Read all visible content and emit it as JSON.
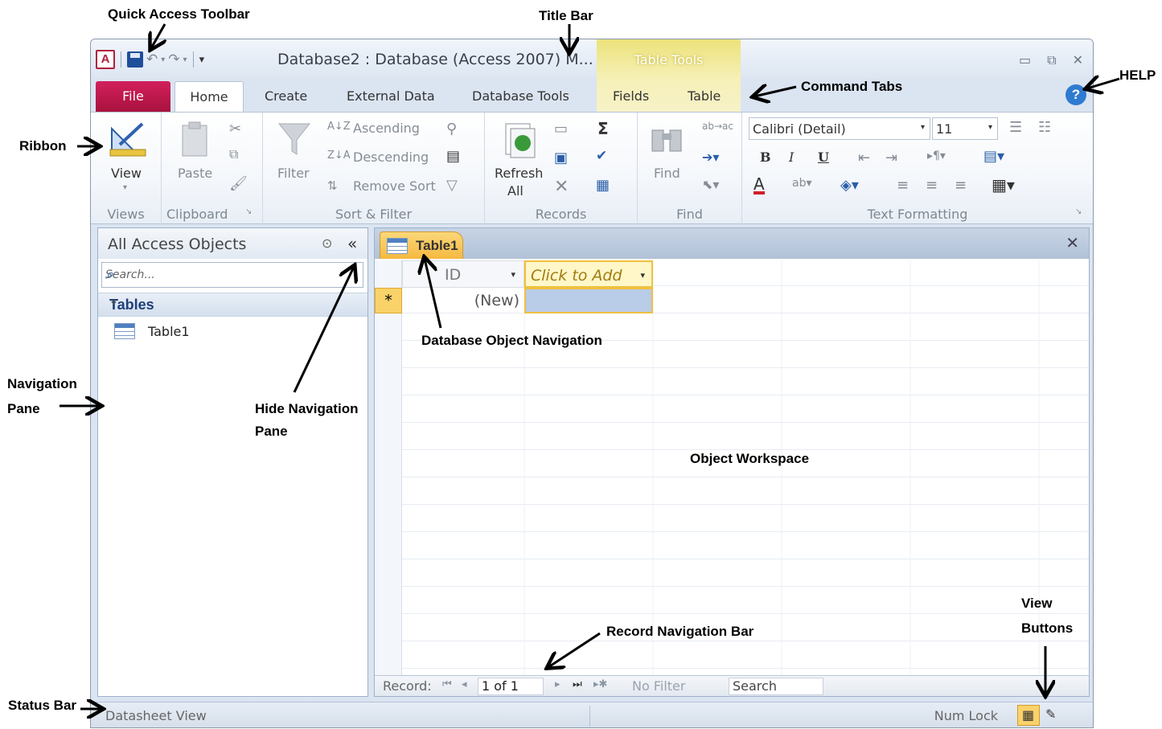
{
  "window": {
    "app_icon": "A",
    "title": "Database2 : Database (Access 2007) M...",
    "contextual_group": "Table Tools",
    "controls": [
      "minimize-icon",
      "restore-icon",
      "close-icon"
    ]
  },
  "tabs": [
    "File",
    "Home",
    "Create",
    "External Data",
    "Database Tools",
    "Fields",
    "Table"
  ],
  "ribbon": {
    "views": {
      "view_label": "View",
      "group_label": "Views"
    },
    "clipboard": {
      "paste_label": "Paste",
      "group_label": "Clipboard"
    },
    "sort_filter": {
      "filter_label": "Filter",
      "ascending": "Ascending",
      "descending": "Descending",
      "remove_sort": "Remove Sort",
      "group_label": "Sort & Filter"
    },
    "records": {
      "refresh_label": "Refresh",
      "refresh_sub": "All",
      "group_label": "Records"
    },
    "find": {
      "find_label": "Find",
      "group_label": "Find"
    },
    "text_formatting": {
      "font_name": "Calibri (Detail)",
      "font_size": "11",
      "bold": "B",
      "italic": "I",
      "underline": "U",
      "font_color_glyph": "A",
      "group_label": "Text Formatting"
    }
  },
  "nav_pane": {
    "title": "All Access Objects",
    "search_placeholder": "Search...",
    "group_title": "Tables",
    "items": [
      "Table1"
    ]
  },
  "document": {
    "tab_label": "Table1",
    "columns": [
      "ID",
      "Click to Add"
    ],
    "new_row_marker": "*",
    "new_row_value": "(New)"
  },
  "record_nav": {
    "label": "Record:",
    "current": "1 of 1",
    "no_filter": "No Filter",
    "search": "Search"
  },
  "status": {
    "view_text": "Datasheet View",
    "num_lock": "Num Lock"
  },
  "callouts": {
    "quick_access_toolbar": "Quick Access Toolbar",
    "title_bar": "Title Bar",
    "command_tabs": "Command Tabs",
    "help": "HELP",
    "ribbon": "Ribbon",
    "navigation_pane_1": "Navigation",
    "navigation_pane_2": "Pane",
    "hide_navigation_1": "Hide Navigation",
    "hide_navigation_2": "Pane",
    "database_object_navigation": "Database Object Navigation",
    "object_workspace": "Object Workspace",
    "record_navigation_bar": "Record Navigation Bar",
    "view_buttons_1": "View",
    "view_buttons_2": "Buttons",
    "status_bar": "Status Bar"
  },
  "colors": {
    "file_tab": "#c01a4d",
    "context_tools": "#efe58a",
    "active_doc_tab": "#f5b940",
    "help_icon": "#2e7bd1",
    "group_header_text": "#1e3f78"
  }
}
